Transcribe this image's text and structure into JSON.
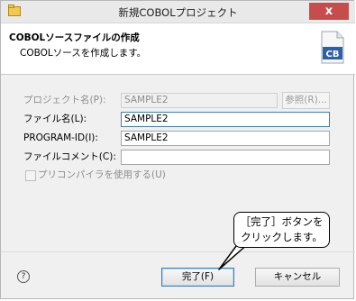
{
  "window": {
    "title": "新規COBOLプロジェクト",
    "close_symbol": "x"
  },
  "banner": {
    "title": "COBOLソースファイルの作成",
    "description": "COBOLソースを作成します。",
    "icon_text": "CB"
  },
  "form": {
    "project_label": "プロジェクト名(P):",
    "project_value": "SAMPLE2",
    "browse_label": "参照(R)...",
    "file_label": "ファイル名(L):",
    "file_value": "SAMPLE2",
    "program_id_label": "PROGRAM-ID(I):",
    "program_id_value": "SAMPLE2",
    "comment_label": "ファイルコメント(C):",
    "comment_value": "",
    "precompiler_label": "プリコンパイラを使用する(U)"
  },
  "footer": {
    "help_symbol": "?",
    "finish_label": "完了(F)",
    "cancel_label": "キャンセル"
  },
  "callout": {
    "line1": "［完了］ボタンを",
    "line2": "クリックします。"
  }
}
